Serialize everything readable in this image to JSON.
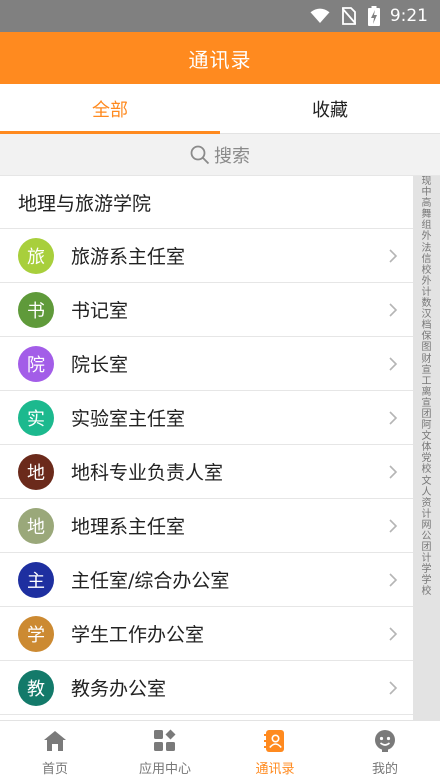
{
  "status_bar": {
    "time": "9:21",
    "icons": [
      "wifi-icon",
      "no-sim-icon",
      "battery-charging-icon"
    ]
  },
  "header": {
    "title": "通讯录"
  },
  "tabs": [
    {
      "label": "全部",
      "active": true
    },
    {
      "label": "收藏",
      "active": false
    }
  ],
  "search": {
    "placeholder": "搜索",
    "icon": "search-icon"
  },
  "section": {
    "title": "地理与旅游学院"
  },
  "contacts": [
    {
      "avatar_char": "旅",
      "label": "旅游系主任室",
      "color": "#a8cf3c"
    },
    {
      "avatar_char": "书",
      "label": "书记室",
      "color": "#5f9a3a"
    },
    {
      "avatar_char": "院",
      "label": "院长室",
      "color": "#a35de8"
    },
    {
      "avatar_char": "实",
      "label": "实验室主任室",
      "color": "#1cb98e"
    },
    {
      "avatar_char": "地",
      "label": "地科专业负责人室",
      "color": "#6b2a1b"
    },
    {
      "avatar_char": "地",
      "label": "地理系主任室",
      "color": "#9aa87a"
    },
    {
      "avatar_char": "主",
      "label": "主任室/综合办公室",
      "color": "#1e2fa0"
    },
    {
      "avatar_char": "学",
      "label": "学生工作办公室",
      "color": "#cc8a32"
    },
    {
      "avatar_char": "教",
      "label": "教务办公室",
      "color": "#137a6a"
    }
  ],
  "index_chars": [
    "现",
    "中",
    "高",
    "舞",
    "组",
    "外",
    "法",
    "信",
    "校",
    "外",
    "计",
    "数",
    "汉",
    "档",
    "保",
    "图",
    "财",
    "宣",
    "工",
    "离",
    "宣",
    "团",
    "阿",
    "文",
    "体",
    "党",
    "校",
    "文",
    "人",
    "资",
    "计",
    "网",
    "公",
    "团",
    "计",
    "学",
    "学",
    "校"
  ],
  "bottom_nav": [
    {
      "label": "首页",
      "icon": "home-icon",
      "active": false
    },
    {
      "label": "应用中心",
      "icon": "apps-icon",
      "active": false
    },
    {
      "label": "通讯录",
      "icon": "contacts-icon",
      "active": true
    },
    {
      "label": "我的",
      "icon": "profile-icon",
      "active": false
    }
  ],
  "colors": {
    "accent": "#ff8a1f",
    "status_bar": "#808080",
    "inactive": "#777777"
  }
}
